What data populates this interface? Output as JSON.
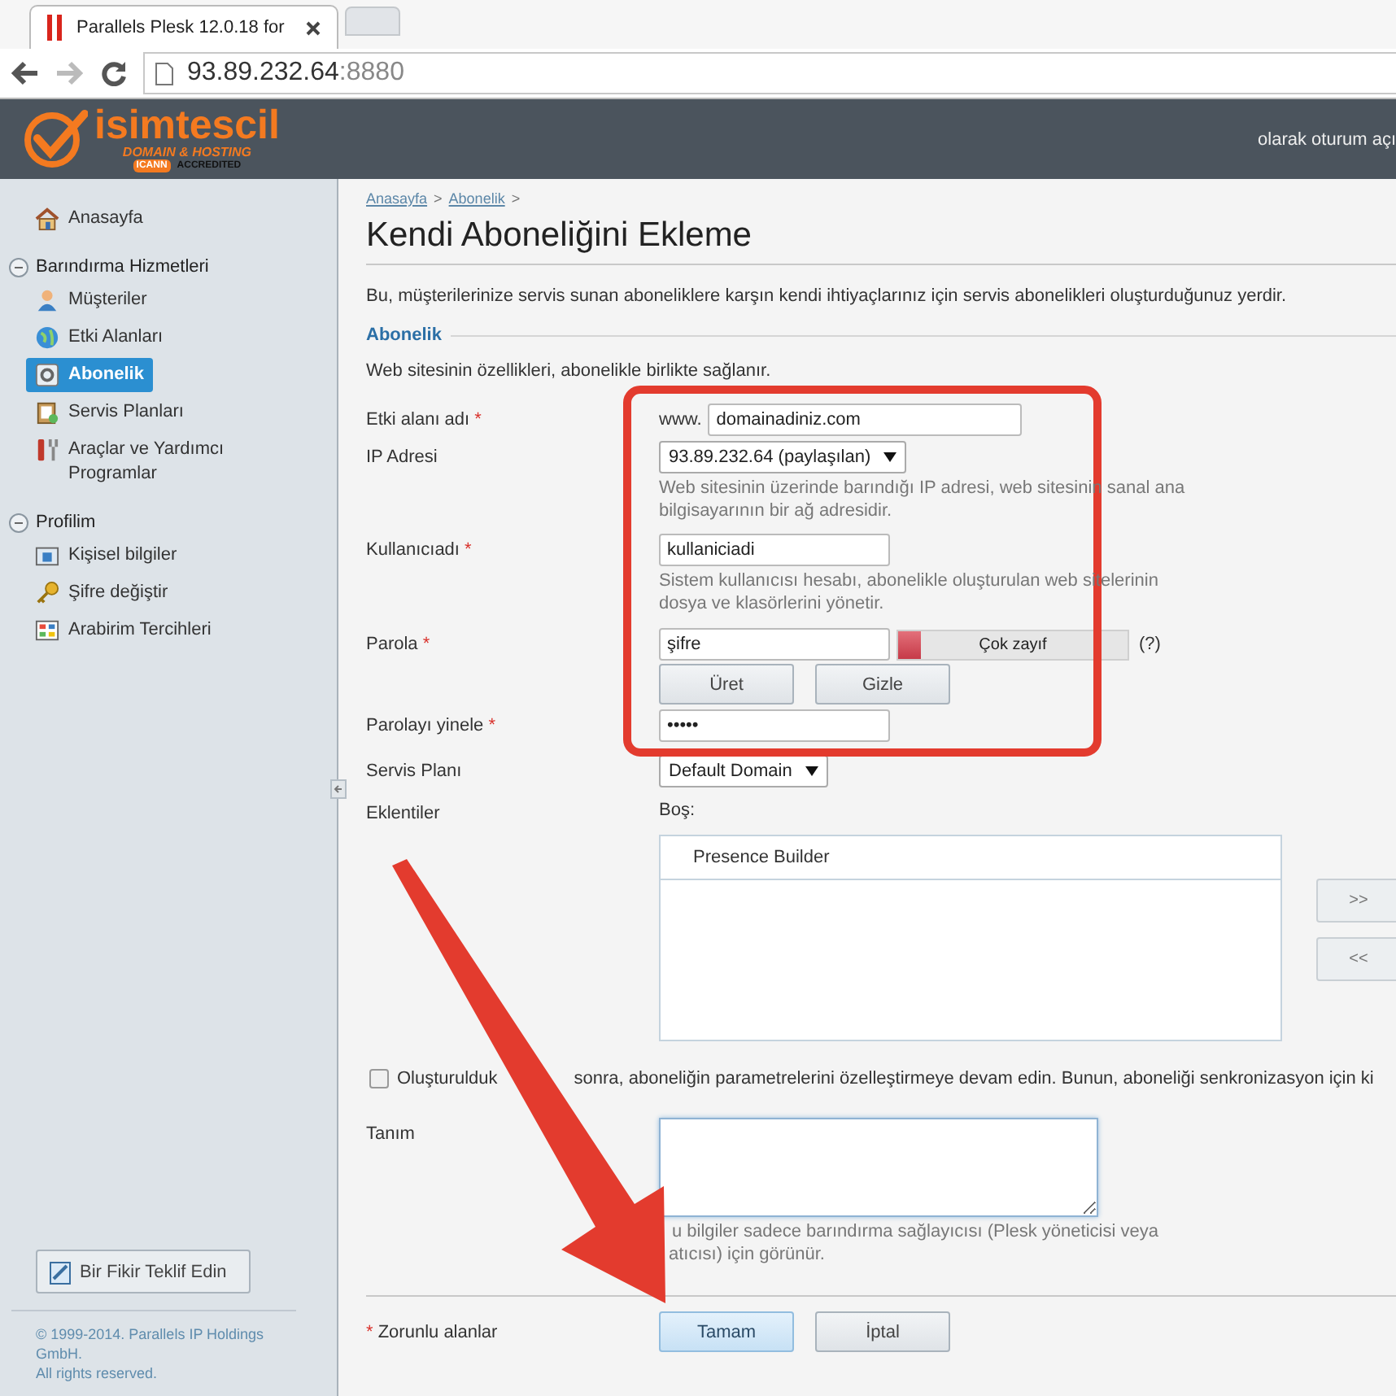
{
  "browser": {
    "tab_title": "Parallels Plesk 12.0.18 for",
    "address_host": "93.89.232.64",
    "address_port": ":8880"
  },
  "header": {
    "logo": {
      "name": "isimtescil",
      "tagline": "DOMAIN & HOSTING",
      "badge": "ICANN",
      "badge_text": "ACCREDITED"
    },
    "login_text": "olarak oturum açı"
  },
  "sidebar": {
    "nav": [
      {
        "label": "Anasayfa",
        "selected": false
      }
    ],
    "groups": [
      {
        "title": "Barındırma Hizmetleri",
        "expanded": true,
        "items": [
          {
            "label": "Müşteriler",
            "selected": false
          },
          {
            "label": "Etki Alanları",
            "selected": false
          },
          {
            "label": "Abonelik",
            "selected": true
          },
          {
            "label": "Servis Planları",
            "selected": false
          },
          {
            "label": "Araçlar ve Yardımcı Programlar",
            "selected": false
          }
        ]
      },
      {
        "title": "Profilim",
        "expanded": true,
        "items": [
          {
            "label": "Kişisel bilgiler",
            "selected": false
          },
          {
            "label": "Şifre değiştir",
            "selected": false
          },
          {
            "label": "Arabirim Tercihleri",
            "selected": false
          }
        ]
      }
    ],
    "feedback_button": "Bir Fikir Teklif Edin",
    "copyright": [
      "© 1999-2014. Parallels IP Holdings GmbH.",
      "All rights reserved."
    ]
  },
  "content": {
    "breadcrumbs": [
      {
        "label": "Anasayfa",
        "separator": ">"
      },
      {
        "label": "Abonelik",
        "separator": ">"
      }
    ],
    "title": "Kendi Aboneliğini Ekleme",
    "description": "Bu, müşterilerinize servis sunan aboneliklere karşın kendi ihtiyaçlarınız için servis abonelikleri oluşturduğunuz yerdir.",
    "section_title": "Abonelik",
    "section_note": "Web sitesinin özellikleri, abonelikle birlikte sağlanır.",
    "fields": [
      {
        "kind": "prefixed",
        "label": "Etki alanı adı",
        "required_mark": "*",
        "prefix": "www.",
        "value": "domainadiniz.com"
      },
      {
        "kind": "select",
        "label": "IP Adresi",
        "value": "93.89.232.64 (paylaşılan)",
        "hint": "Web sitesinin üzerinde barındığı IP adresi, web sitesinin sanal ana bilgisayarının bir ağ adresidir."
      },
      {
        "kind": "text",
        "label": "Kullanıcıadı",
        "required_mark": "*",
        "value": "kullaniciadi",
        "hint": "Sistem kullanıcısı hesabı, abonelikle oluşturulan web sitelerinin dosya ve klasörlerini yönetir."
      },
      {
        "kind": "password",
        "label": "Parola",
        "required_mark": "*",
        "value": "şifre",
        "strength": {
          "label": "Çok zayıf",
          "level": 0.1
        },
        "help": "(?)",
        "buttons": [
          "Üret",
          "Gizle"
        ]
      },
      {
        "kind": "text",
        "label": "Parolayı yinele",
        "required_mark": "*",
        "value": "•••••"
      },
      {
        "kind": "select",
        "label": "Servis Planı",
        "value": "Default Domain"
      },
      {
        "kind": "addons",
        "label": "Eklentiler",
        "list_title": "Boş:",
        "available": [
          "Presence Builder"
        ],
        "move_buttons": [
          ">>",
          "<<"
        ]
      }
    ],
    "customize_checkbox": {
      "checked": false,
      "text_before": "Oluşturulduk",
      "text_after": "sonra, aboneliğin parametrelerini özelleştirmeye devam edin. Bunun, aboneliği senkronizasyon için ki"
    },
    "description_field": {
      "label": "Tanım",
      "focused": true,
      "hint_lines": [
        "u bilgiler sadece barındırma sağlayıcısı (Plesk yöneticisi veya",
        "atıcısı) için görünür."
      ]
    },
    "footer": {
      "required_mark": "*",
      "required_note": "Zorunlu alanlar",
      "buttons": [
        {
          "label": "Tamam",
          "kind": "primary"
        },
        {
          "label": "İptal",
          "kind": "secondary"
        }
      ]
    }
  },
  "annotations": {
    "highlight_frame": true,
    "arrow": true
  }
}
